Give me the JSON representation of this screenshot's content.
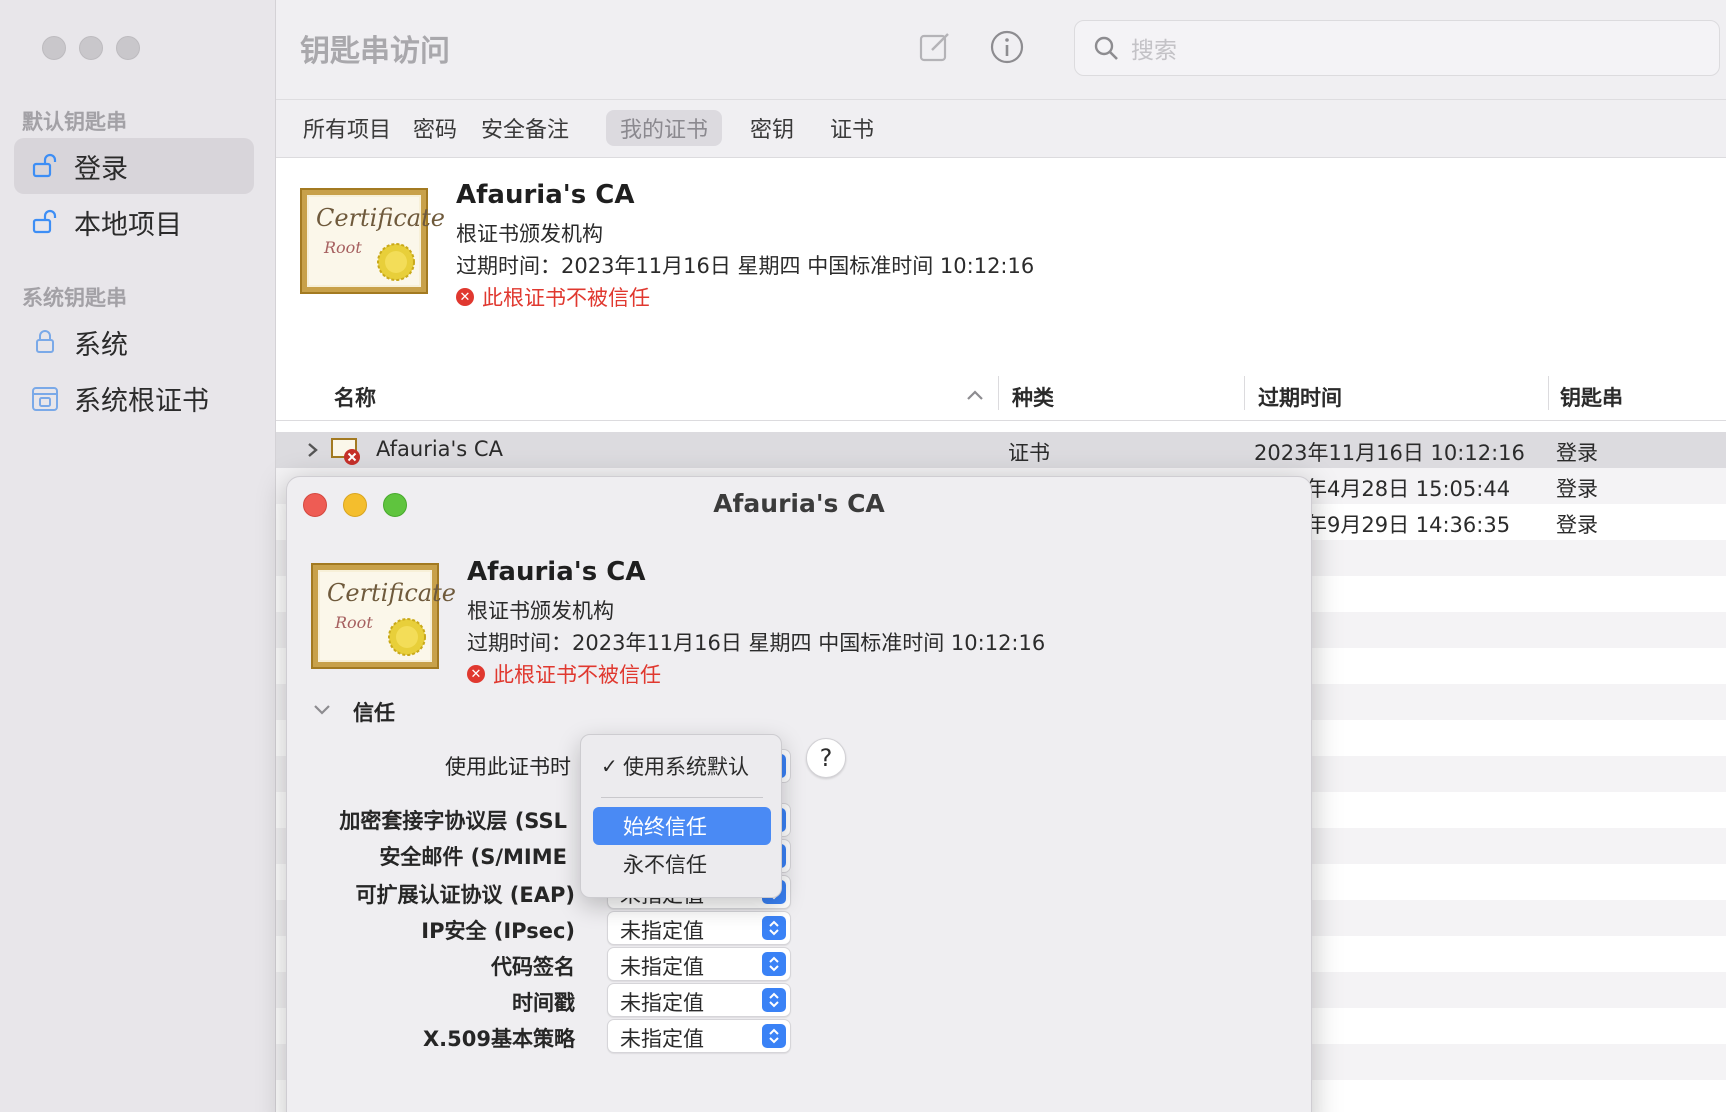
{
  "window": {
    "title": "钥匙串访问"
  },
  "sidebar": {
    "default_heading": "默认钥匙串",
    "default_items": [
      {
        "label": "登录",
        "icon": "unlocked-lock-icon",
        "selected": true
      },
      {
        "label": "本地项目",
        "icon": "unlocked-lock-icon",
        "selected": false
      }
    ],
    "system_heading": "系统钥匙串",
    "system_items": [
      {
        "label": "系统",
        "icon": "lock-icon"
      },
      {
        "label": "系统根证书",
        "icon": "cabinet-icon"
      }
    ]
  },
  "toolbar": {
    "search_placeholder": "搜索",
    "compose_icon": "compose-icon",
    "info_icon": "info-icon"
  },
  "tabs": [
    {
      "label": "所有项目",
      "active": false
    },
    {
      "label": "密码",
      "active": false
    },
    {
      "label": "安全备注",
      "active": false
    },
    {
      "label": "我的证书",
      "active": true
    },
    {
      "label": "密钥",
      "active": false
    },
    {
      "label": "证书",
      "active": false
    }
  ],
  "cert_header": {
    "image_text_1": "Certificate",
    "image_text_2": "Root",
    "name": "Afauria's CA",
    "type": "根证书颁发机构",
    "expires": "过期时间：2023年11月16日 星期四 中国标准时间 10:12:16",
    "warning": "此根证书不被信任"
  },
  "table": {
    "columns": [
      "名称",
      "种类",
      "过期时间",
      "钥匙串"
    ],
    "rows": [
      {
        "name": "Afauria's CA",
        "kind": "证书",
        "expires": "2023年11月16日 10:12:16",
        "keychain": "登录"
      },
      {
        "name": "",
        "kind": "",
        "expires": "年4月28日 15:05:44",
        "keychain": "登录"
      },
      {
        "name": "",
        "kind": "",
        "expires": "年9月29日 14:36:35",
        "keychain": "登录"
      }
    ]
  },
  "dialog": {
    "title": "Afauria's CA",
    "image_text_1": "Certificate",
    "image_text_2": "Root",
    "name": "Afauria's CA",
    "type": "根证书颁发机构",
    "expires": "过期时间：2023年11月16日 星期四 中国标准时间 10:12:16",
    "warning": "此根证书不被信任",
    "trust_section": "信任",
    "when_using_label": "使用此证书时",
    "trust_rows": [
      {
        "label": "加密套接字协议层 (SSL",
        "value": ""
      },
      {
        "label": "安全邮件 (S/MIME",
        "value": ""
      },
      {
        "label": "可扩展认证协议 (EAP)",
        "value": "未指定值"
      },
      {
        "label": "IP安全 (IPsec)",
        "value": "未指定值"
      },
      {
        "label": "代码签名",
        "value": "未指定值"
      },
      {
        "label": "时间戳",
        "value": "未指定值"
      },
      {
        "label": "X.509基本策略",
        "value": "未指定值"
      }
    ],
    "help": "?"
  },
  "menu": {
    "items": [
      {
        "label": "使用系统默认",
        "checked": true,
        "highlighted": false
      },
      {
        "label": "始终信任",
        "checked": false,
        "highlighted": true
      },
      {
        "label": "永不信任",
        "checked": false,
        "highlighted": false
      }
    ],
    "check_mark": "✓"
  },
  "colors": {
    "accent": "#3a82f6",
    "menu_highlight": "#4a8af4",
    "error": "#e0382f",
    "close": "#ee5c54",
    "minimize": "#f4be2d",
    "zoom": "#5fc43e"
  }
}
